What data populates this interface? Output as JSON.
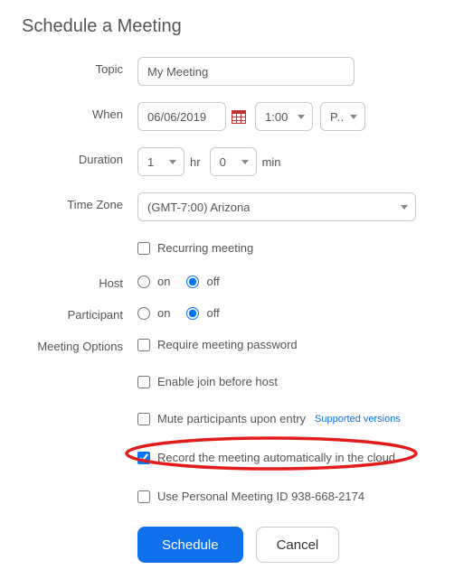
{
  "title": "Schedule a Meeting",
  "labels": {
    "topic": "Topic",
    "when": "When",
    "duration": "Duration",
    "timezone": "Time Zone",
    "host": "Host",
    "participant": "Participant",
    "options": "Meeting Options"
  },
  "topic": {
    "value": "My Meeting"
  },
  "when": {
    "date": "06/06/2019",
    "time": "1:00",
    "ampm": "P..."
  },
  "duration": {
    "hours": "1",
    "hr_unit": "hr",
    "minutes": "0",
    "min_unit": "min"
  },
  "timezone": {
    "value": "(GMT-7:00) Arizona"
  },
  "recurring": {
    "label": "Recurring meeting",
    "checked": false
  },
  "host_video": {
    "on": "on",
    "off": "off",
    "value": "off"
  },
  "participant_video": {
    "on": "on",
    "off": "off",
    "value": "off"
  },
  "options": {
    "password": {
      "label": "Require meeting password",
      "checked": false
    },
    "join_before": {
      "label": "Enable join before host",
      "checked": false
    },
    "mute_entry": {
      "label": "Mute participants upon entry",
      "checked": false,
      "supported": "Supported versions"
    },
    "auto_record": {
      "label": "Record the meeting automatically in the cloud",
      "checked": true
    },
    "pmi": {
      "label": "Use Personal Meeting ID 938-668-2174",
      "checked": false
    }
  },
  "buttons": {
    "schedule": "Schedule",
    "cancel": "Cancel"
  }
}
